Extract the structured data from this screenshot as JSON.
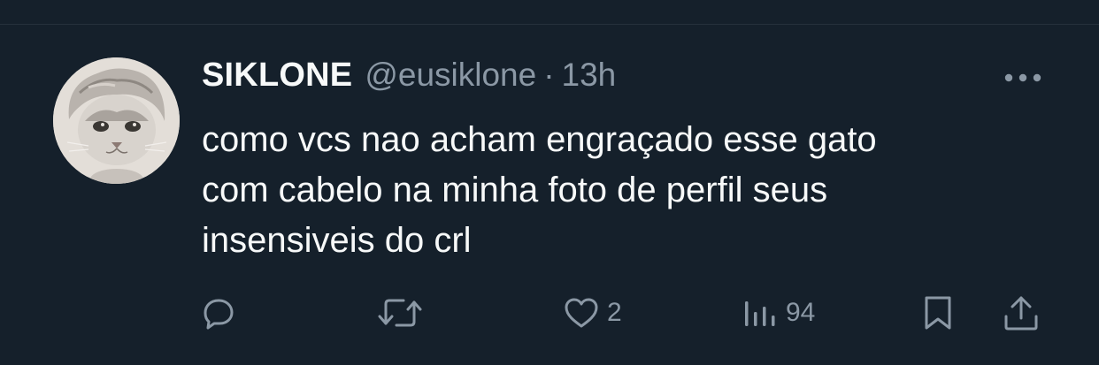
{
  "tweet": {
    "display_name": "SIKLONE",
    "handle": "@eusiklone",
    "separator": "·",
    "time": "13h",
    "text": "como vcs nao acham engraçado esse gato\ncom cabelo na minha foto de perfil seus\ninsensiveis do crl"
  },
  "actions": {
    "reply": {
      "icon": "reply-icon",
      "count": ""
    },
    "retweet": {
      "icon": "retweet-icon",
      "count": ""
    },
    "like": {
      "icon": "heart-icon",
      "count": "2"
    },
    "views": {
      "icon": "views-icon",
      "count": "94"
    },
    "bookmark": {
      "icon": "bookmark-icon"
    },
    "share": {
      "icon": "share-icon"
    }
  },
  "colors": {
    "background": "#15202b",
    "primary_text": "#f7f9f9",
    "secondary_text": "#8b98a5"
  }
}
